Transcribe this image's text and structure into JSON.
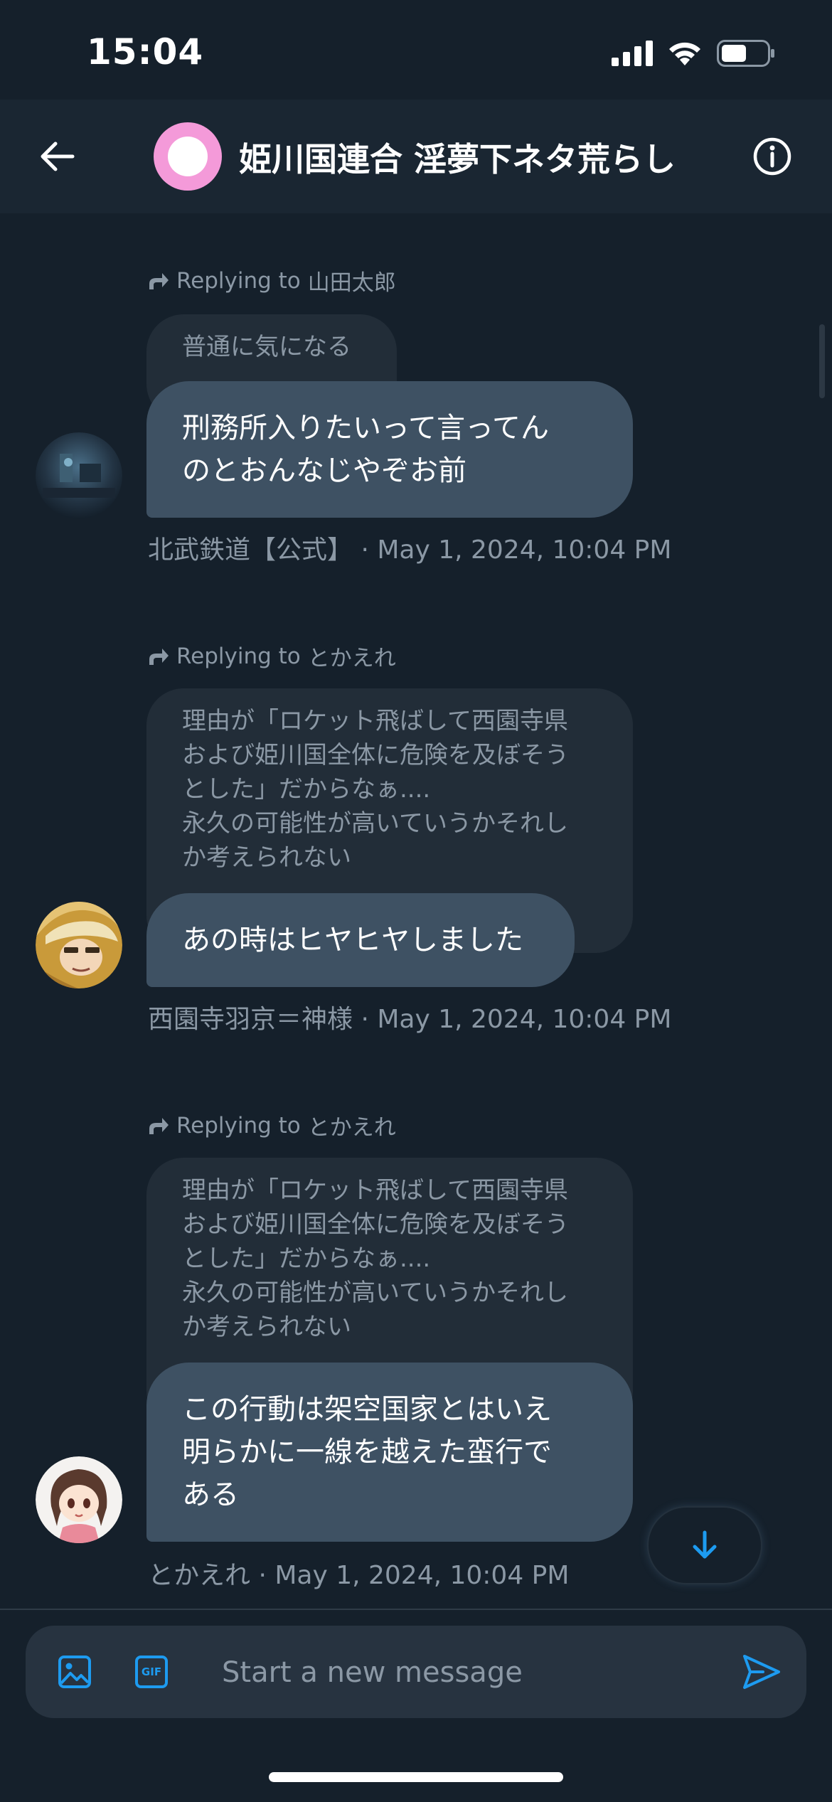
{
  "status_bar": {
    "time": "15:04"
  },
  "header": {
    "title": "姫川国連合 淫夢下ネタ荒らし"
  },
  "messages": [
    {
      "replying_prefix": "Replying to",
      "replying_to": "山田太郎",
      "quoted_text": "普通に気になる",
      "text": "刑務所入りたいって言ってん\nのとおんなじやぞお前",
      "meta": "北武鉄道【公式】 · May 1, 2024, 10:04 PM"
    },
    {
      "replying_prefix": "Replying to",
      "replying_to": "とかえれ",
      "quoted_text": "理由が「ロケット飛ばして西園寺県\nおよび姫川国全体に危険を及ぼそう\nとした」だからなぁ....\n永久の可能性が高いていうかそれし\nか考えられない",
      "text": "あの時はヒヤヒヤしました",
      "meta": "西園寺羽京＝神様 · May 1, 2024, 10:04 PM"
    },
    {
      "replying_prefix": "Replying to",
      "replying_to": "とかえれ",
      "quoted_text": "理由が「ロケット飛ばして西園寺県\nおよび姫川国全体に危険を及ぼそう\nとした」だからなぁ....\n永久の可能性が高いていうかそれし\nか考えられない",
      "text": "この行動は架空国家とはいえ\n明らかに一線を越えた蛮行で\nある",
      "meta": "とかえれ · May 1, 2024, 10:04 PM"
    }
  ],
  "composer": {
    "placeholder": "Start a new message",
    "gif_label": "GIF"
  },
  "colors": {
    "background": "#15202b",
    "bubble": "#3e5163",
    "quoted_bubble": "#222d38",
    "accent": "#1d9bf0",
    "muted_text": "#8b98a5",
    "group_avatar": "#f49ad9"
  },
  "icons": {
    "back": "arrow-left-icon",
    "info": "info-icon",
    "reply": "reply-arrow-icon",
    "image": "image-icon",
    "gif": "gif-icon",
    "send": "send-icon",
    "scroll_down": "arrow-down-icon"
  }
}
